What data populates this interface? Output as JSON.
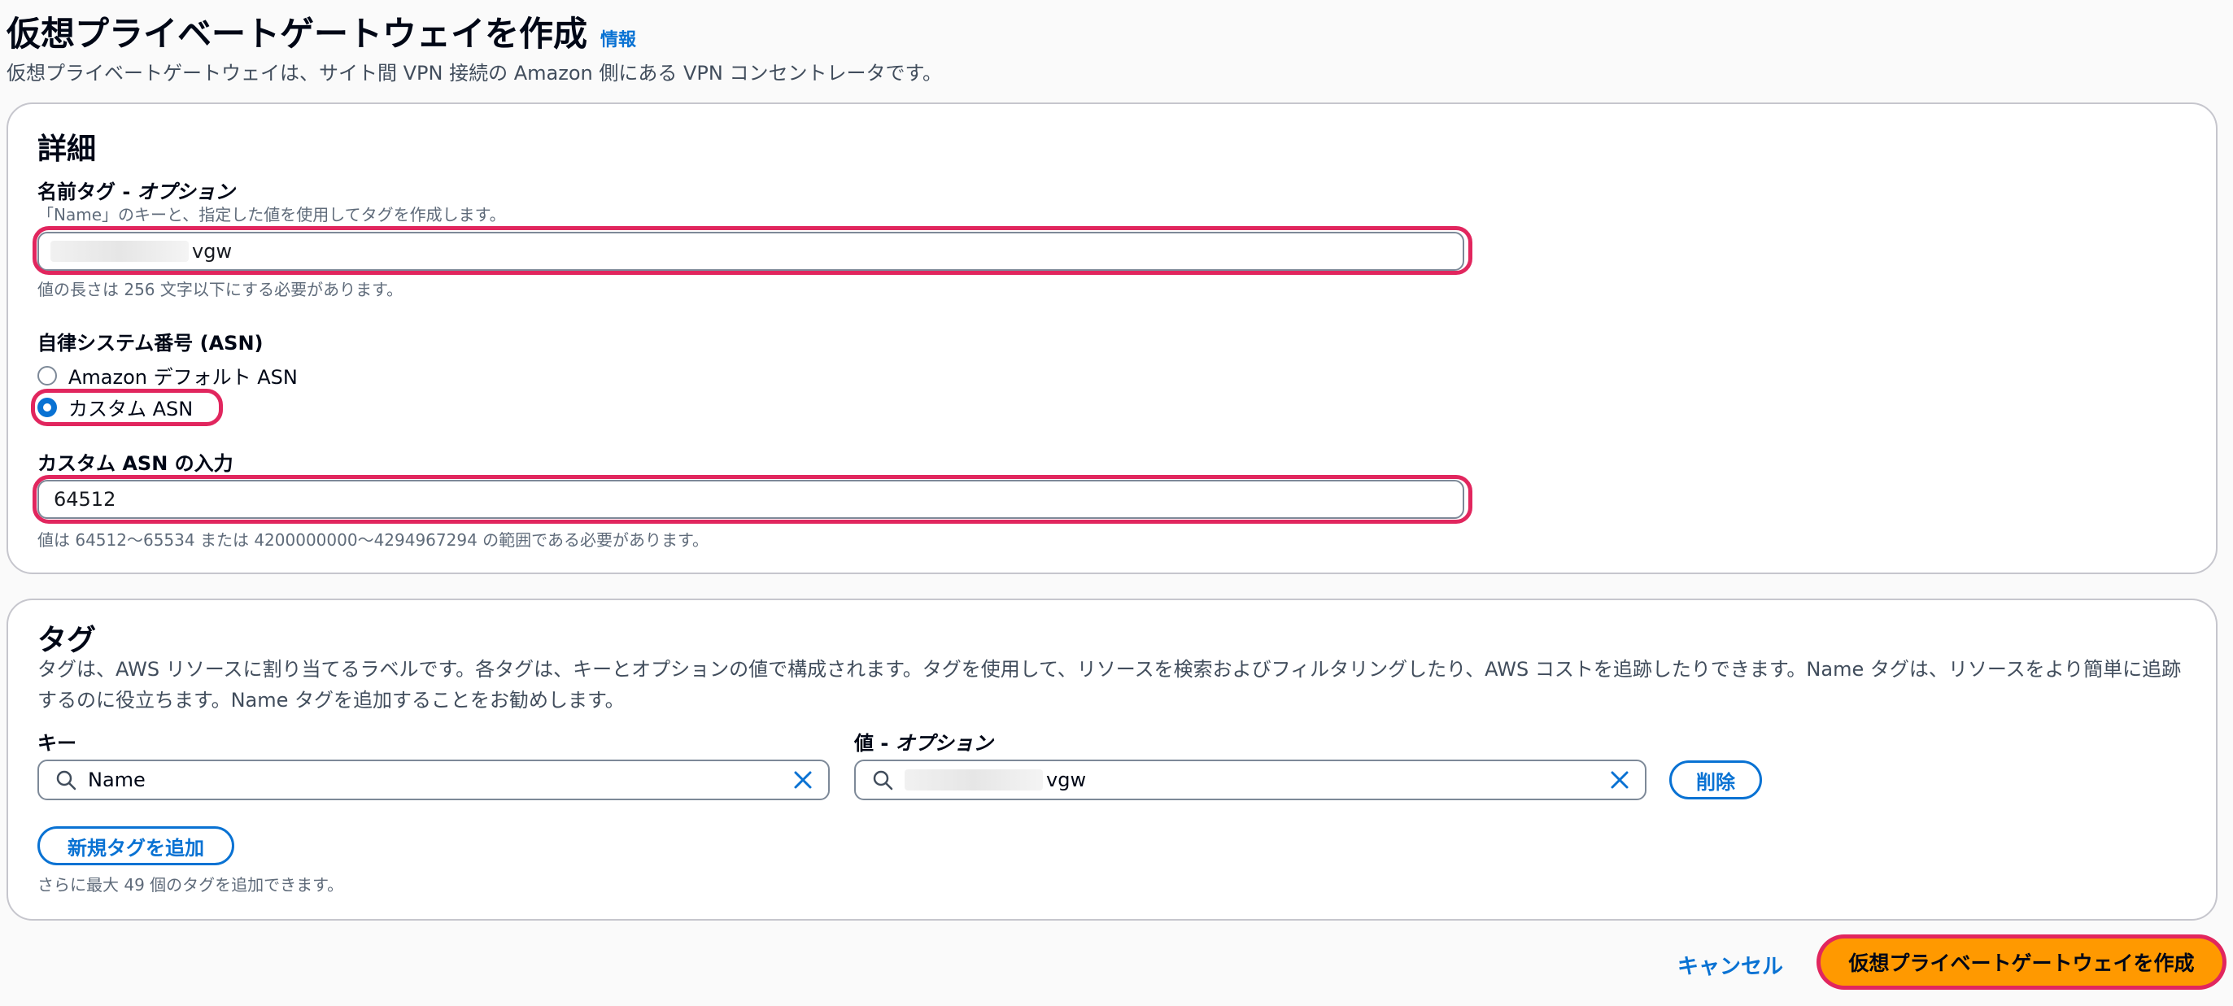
{
  "header": {
    "title": "仮想プライベートゲートウェイを作成",
    "info_link": "情報",
    "description": "仮想プライベートゲートウェイは、サイト間 VPN 接続の Amazon 側にある VPN コンセントレータです。"
  },
  "details": {
    "heading": "詳細",
    "name_tag": {
      "label": "名前タグ - ",
      "label_optional": "オプション",
      "description": "「Name」のキーと、指定した値を使用してタグを作成します。",
      "value": "vgw",
      "constraint": "値の長さは 256 文字以下にする必要があります。"
    },
    "asn": {
      "label": "自律システム番号 (ASN)",
      "options": [
        "Amazon デフォルト ASN",
        "カスタム ASN"
      ],
      "selected": "カスタム ASN"
    },
    "custom_asn": {
      "label": "カスタム ASN の入力",
      "value": "64512",
      "constraint": "値は 64512〜65534 または 4200000000〜4294967294 の範囲である必要があります。"
    }
  },
  "tags": {
    "heading": "タグ",
    "description": "タグは、AWS リソースに割り当てるラベルです。各タグは、キーとオプションの値で構成されます。タグを使用して、リソースを検索およびフィルタリングしたり、AWS コストを追跡したりできます。Name タグは、リソースをより簡単に追跡するのに役立ちます。Name タグを追加することをお勧めします。",
    "key_label": "キー",
    "value_label": "値 - ",
    "value_label_optional": "オプション",
    "rows": [
      {
        "key": "Name",
        "value": "vgw",
        "remove_label": "削除"
      }
    ],
    "add_button": "新規タグを追加",
    "remaining": "さらに最大 49 個のタグを追加できます。"
  },
  "footer": {
    "cancel": "キャンセル",
    "submit": "仮想プライベートゲートウェイを作成"
  },
  "colors": {
    "accent": "#0972d3",
    "primary_button": "#ff9900",
    "highlight": "#e1265e"
  }
}
